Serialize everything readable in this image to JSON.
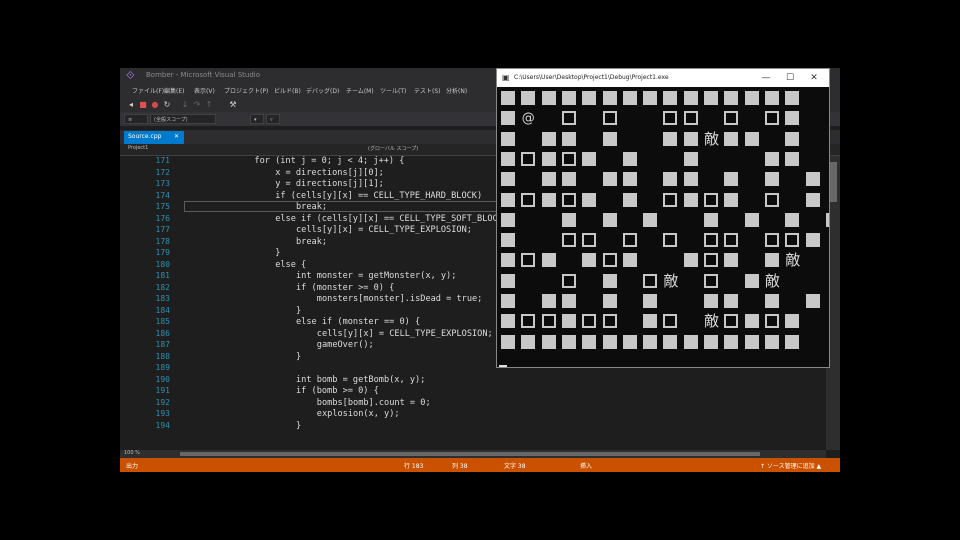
{
  "ide": {
    "title": "Bomber - Microsoft Visual Studio",
    "menu": [
      "ファイル(F)",
      "編集(E)",
      "表示(V)",
      "プロジェクト(P)",
      "ビルド(B)",
      "デバッグ(D)",
      "チーム(M)",
      "ツール(T)",
      "テスト(S)",
      "分析(N)"
    ],
    "nav": {
      "project": "(全般スコープ)",
      "scope": "(グローバル スコープ)"
    },
    "tab": {
      "label": "Source.cpp",
      "close": "✕"
    },
    "project_label": "Project1",
    "scope_label": "(グローバル スコープ)",
    "zoom": "100 %",
    "code_lines": [
      {
        "n": "171",
        "indent": 12,
        "text": "for (int j = 0; j < 4; j++) {"
      },
      {
        "n": "172",
        "indent": 16,
        "text": "x = directions[j][0];"
      },
      {
        "n": "173",
        "indent": 16,
        "text": "y = directions[j][1];"
      },
      {
        "n": "174",
        "indent": 16,
        "text": "if (cells[y][x] == CELL_TYPE_HARD_BLOCK)"
      },
      {
        "n": "175",
        "indent": 20,
        "text": "break;"
      },
      {
        "n": "176",
        "indent": 16,
        "text": "else if (cells[y][x] == CELL_TYPE_SOFT_BLOCK) {"
      },
      {
        "n": "177",
        "indent": 20,
        "text": "cells[y][x] = CELL_TYPE_EXPLOSION;"
      },
      {
        "n": "178",
        "indent": 20,
        "text": "break;"
      },
      {
        "n": "179",
        "indent": 16,
        "text": "}"
      },
      {
        "n": "180",
        "indent": 16,
        "text": "else {"
      },
      {
        "n": "181",
        "indent": 20,
        "text": "int monster = getMonster(x, y);"
      },
      {
        "n": "182",
        "indent": 20,
        "text": "if (monster >= 0) {"
      },
      {
        "n": "183",
        "indent": 24,
        "text": "monsters[monster].isDead = true;"
      },
      {
        "n": "184",
        "indent": 20,
        "text": "}"
      },
      {
        "n": "185",
        "indent": 20,
        "text": "else if (monster == 0) {"
      },
      {
        "n": "186",
        "indent": 24,
        "text": "cells[y][x] = CELL_TYPE_EXPLOSION;"
      },
      {
        "n": "187",
        "indent": 24,
        "text": "gameOver();"
      },
      {
        "n": "188",
        "indent": 20,
        "text": "}"
      },
      {
        "n": "189",
        "indent": 20,
        "text": ""
      },
      {
        "n": "190",
        "indent": 20,
        "text": "int bomb = getBomb(x, y);"
      },
      {
        "n": "191",
        "indent": 20,
        "text": "if (bomb >= 0) {"
      },
      {
        "n": "192",
        "indent": 24,
        "text": "bombs[bomb].count = 0;"
      },
      {
        "n": "193",
        "indent": 24,
        "text": "explosion(x, y);"
      },
      {
        "n": "194",
        "indent": 20,
        "text": "}"
      }
    ],
    "status": {
      "message": "出力",
      "line": "行 183",
      "col": "列 38",
      "ch": "文字 38",
      "mode": "挿入",
      "publish": "↑ ソース管理に追加 ▲"
    }
  },
  "console": {
    "path": "C:\\Users\\User\\Desktop\\Project1\\Debug\\Project1.exe",
    "buttons": {
      "min": "—",
      "max": "☐",
      "close": "✕"
    },
    "player_char": "@",
    "enemy_char": "敵",
    "grid": [
      "###############",
      "#@ . .  .. . .#",
      "# ## #  ##敵## #",
      "#.#.# #  #   ##",
      "# ## ## ## # # #",
      "#.#.# # .#.# . #",
      "#  # # #  # # # #",
      "#  .. . . .. ..#",
      "#.# #.#  #.# #敵",
      "#  . # .敵 . #敵",
      "# ## # #  ## # #",
      "#..#.. #. 敵.#.#",
      "###############"
    ]
  }
}
